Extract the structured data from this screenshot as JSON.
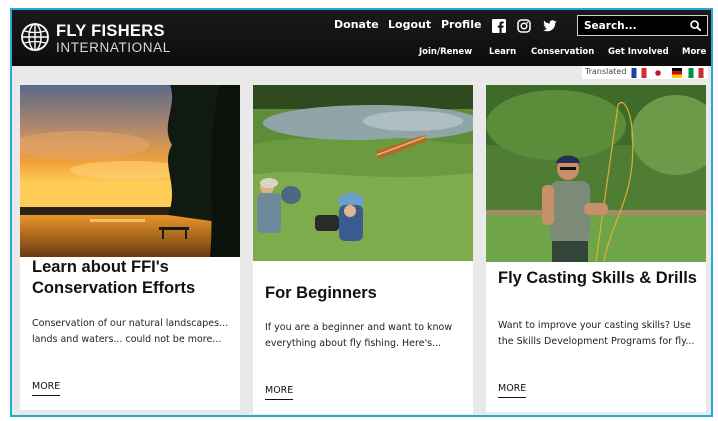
{
  "brand": {
    "name": "FLY FISHERS",
    "subtitle": "INTERNATIONAL"
  },
  "top_links": {
    "donate": "Donate",
    "logout": "Logout",
    "profile": "Profile"
  },
  "social": [
    "facebook-icon",
    "instagram-icon",
    "twitter-icon"
  ],
  "search": {
    "placeholder": "Search..."
  },
  "nav": {
    "join": "Join/Renew",
    "learn": "Learn",
    "conservation": "Conservation",
    "involved": "Get Involved",
    "more": "More"
  },
  "translate": {
    "label": "Translated",
    "flags": [
      "france",
      "japan",
      "germany",
      "italy"
    ]
  },
  "cards": [
    {
      "title": "Learn about FFI's Conservation Efforts",
      "description": "Conservation of our natural landscapes... lands and waters... could not be more...",
      "more": "MORE"
    },
    {
      "title": "For Beginners",
      "description": "If you are a beginner and want to know everything about fly fishing. Here's...",
      "more": "MORE"
    },
    {
      "title": "Fly Casting Skills & Drills",
      "description": "Want to improve your casting skills?  Use the Skills Development Programs for fly...",
      "more": "MORE"
    }
  ],
  "colors": {
    "header_bg": "#111111",
    "frame_border": "#29a8d8",
    "page_bg": "#e9e9e9"
  }
}
